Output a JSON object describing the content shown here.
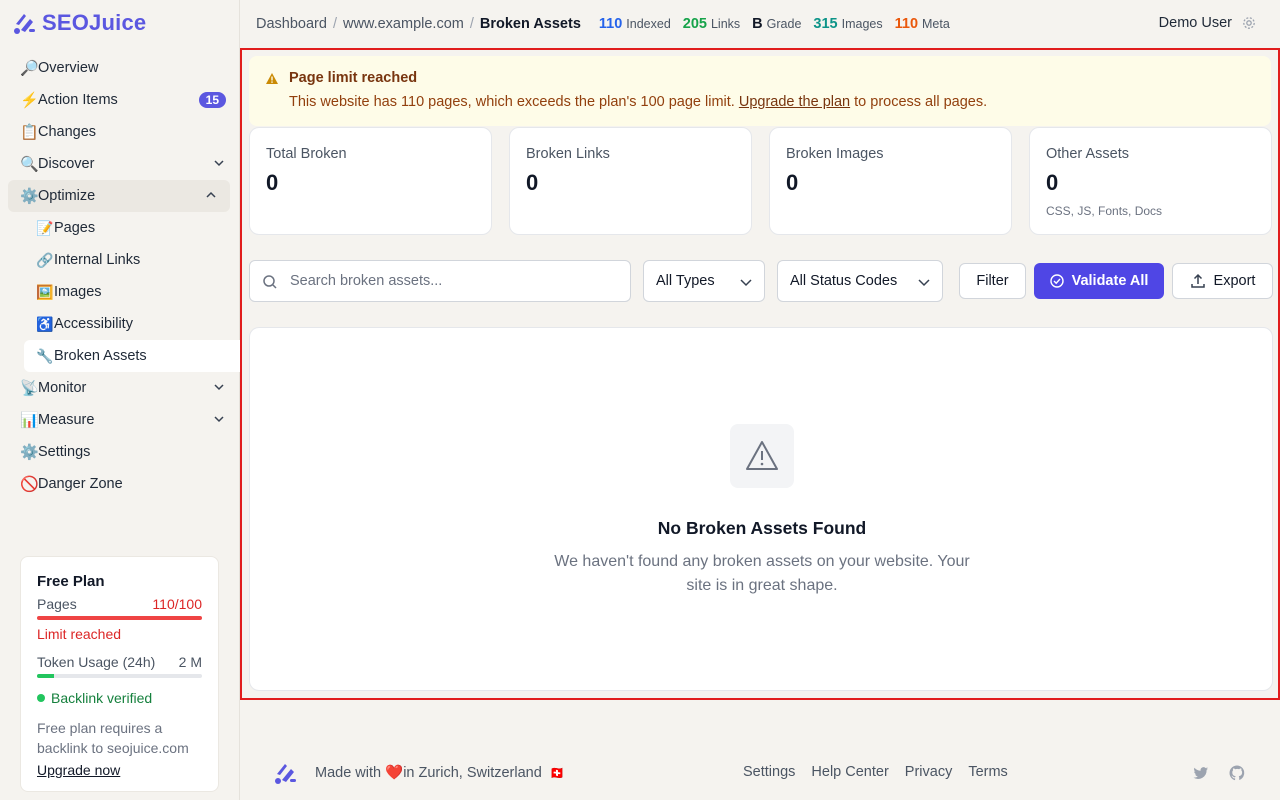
{
  "brand": {
    "name": "SEOJuice",
    "color": "#5b57e0"
  },
  "sidebar": {
    "items": [
      {
        "emoji": "🔎",
        "label": "Overview"
      },
      {
        "emoji": "⚡",
        "label": "Action Items",
        "badge": "15"
      },
      {
        "emoji": "📋",
        "label": "Changes"
      },
      {
        "emoji": "🔍",
        "label": "Discover"
      },
      {
        "emoji": "⚙️",
        "label": "Optimize"
      }
    ],
    "optimize_sub": [
      {
        "emoji": "📝",
        "label": "Pages"
      },
      {
        "emoji": "🔗",
        "label": "Internal Links"
      },
      {
        "emoji": "🖼️",
        "label": "Images"
      },
      {
        "emoji": "♿",
        "label": "Accessibility"
      },
      {
        "emoji": "🔧",
        "label": "Broken Assets"
      }
    ],
    "items_after": [
      {
        "emoji": "📡",
        "label": "Monitor"
      },
      {
        "emoji": "📊",
        "label": "Measure"
      },
      {
        "emoji": "⚙️",
        "label": "Settings"
      },
      {
        "emoji": "🚫",
        "label": "Danger Zone"
      }
    ]
  },
  "plan": {
    "title": "Free Plan",
    "pages_label": "Pages",
    "pages_value": "110/100",
    "pages_fraction": 1.0,
    "limit_text": "Limit reached",
    "token_label": "Token Usage (24h)",
    "token_value": "2 M",
    "token_fraction": 0.1,
    "verified_text": "Backlink verified",
    "note": "Free plan requires a backlink to seojuice.com",
    "upgrade_label": "Upgrade now"
  },
  "topbar": {
    "breadcrumb": [
      "Dashboard",
      "www.example.com",
      "Broken Assets"
    ],
    "stats": [
      {
        "value": "110",
        "label": "Indexed",
        "color": "#2563eb"
      },
      {
        "value": "205",
        "label": "Links",
        "color": "#16a34a"
      },
      {
        "value": "B",
        "label": "Grade",
        "color": "#111827"
      },
      {
        "value": "315",
        "label": "Images",
        "color": "#0d9488"
      },
      {
        "value": "110",
        "label": "Meta",
        "color": "#ea580c"
      }
    ],
    "user": "Demo User"
  },
  "alert": {
    "title": "Page limit reached",
    "message_pre": "This website has 110 pages, which exceeds the plan's 100 page limit. ",
    "link": "Upgrade the plan",
    "message_post": " to process all pages."
  },
  "cards": [
    {
      "label": "Total Broken",
      "value": "0",
      "hint": ""
    },
    {
      "label": "Broken Links",
      "value": "0",
      "hint": ""
    },
    {
      "label": "Broken Images",
      "value": "0",
      "hint": ""
    },
    {
      "label": "Other Assets",
      "value": "0",
      "hint": "CSS, JS, Fonts, Docs"
    }
  ],
  "toolbar": {
    "search_placeholder": "Search broken assets...",
    "type_select": "All Types",
    "status_select": "All Status Codes",
    "filter_label": "Filter",
    "validate_label": "Validate All",
    "export_label": "Export"
  },
  "empty": {
    "title": "No Broken Assets Found",
    "message": "We haven't found any broken assets on your website. Your site is in great shape."
  },
  "footer": {
    "made_pre": "Made with",
    "heart": "❤️",
    "made_post": "in Zurich, Switzerland",
    "flag": "🇨🇭",
    "links": [
      "Settings",
      "Help Center",
      "Privacy",
      "Terms"
    ]
  }
}
